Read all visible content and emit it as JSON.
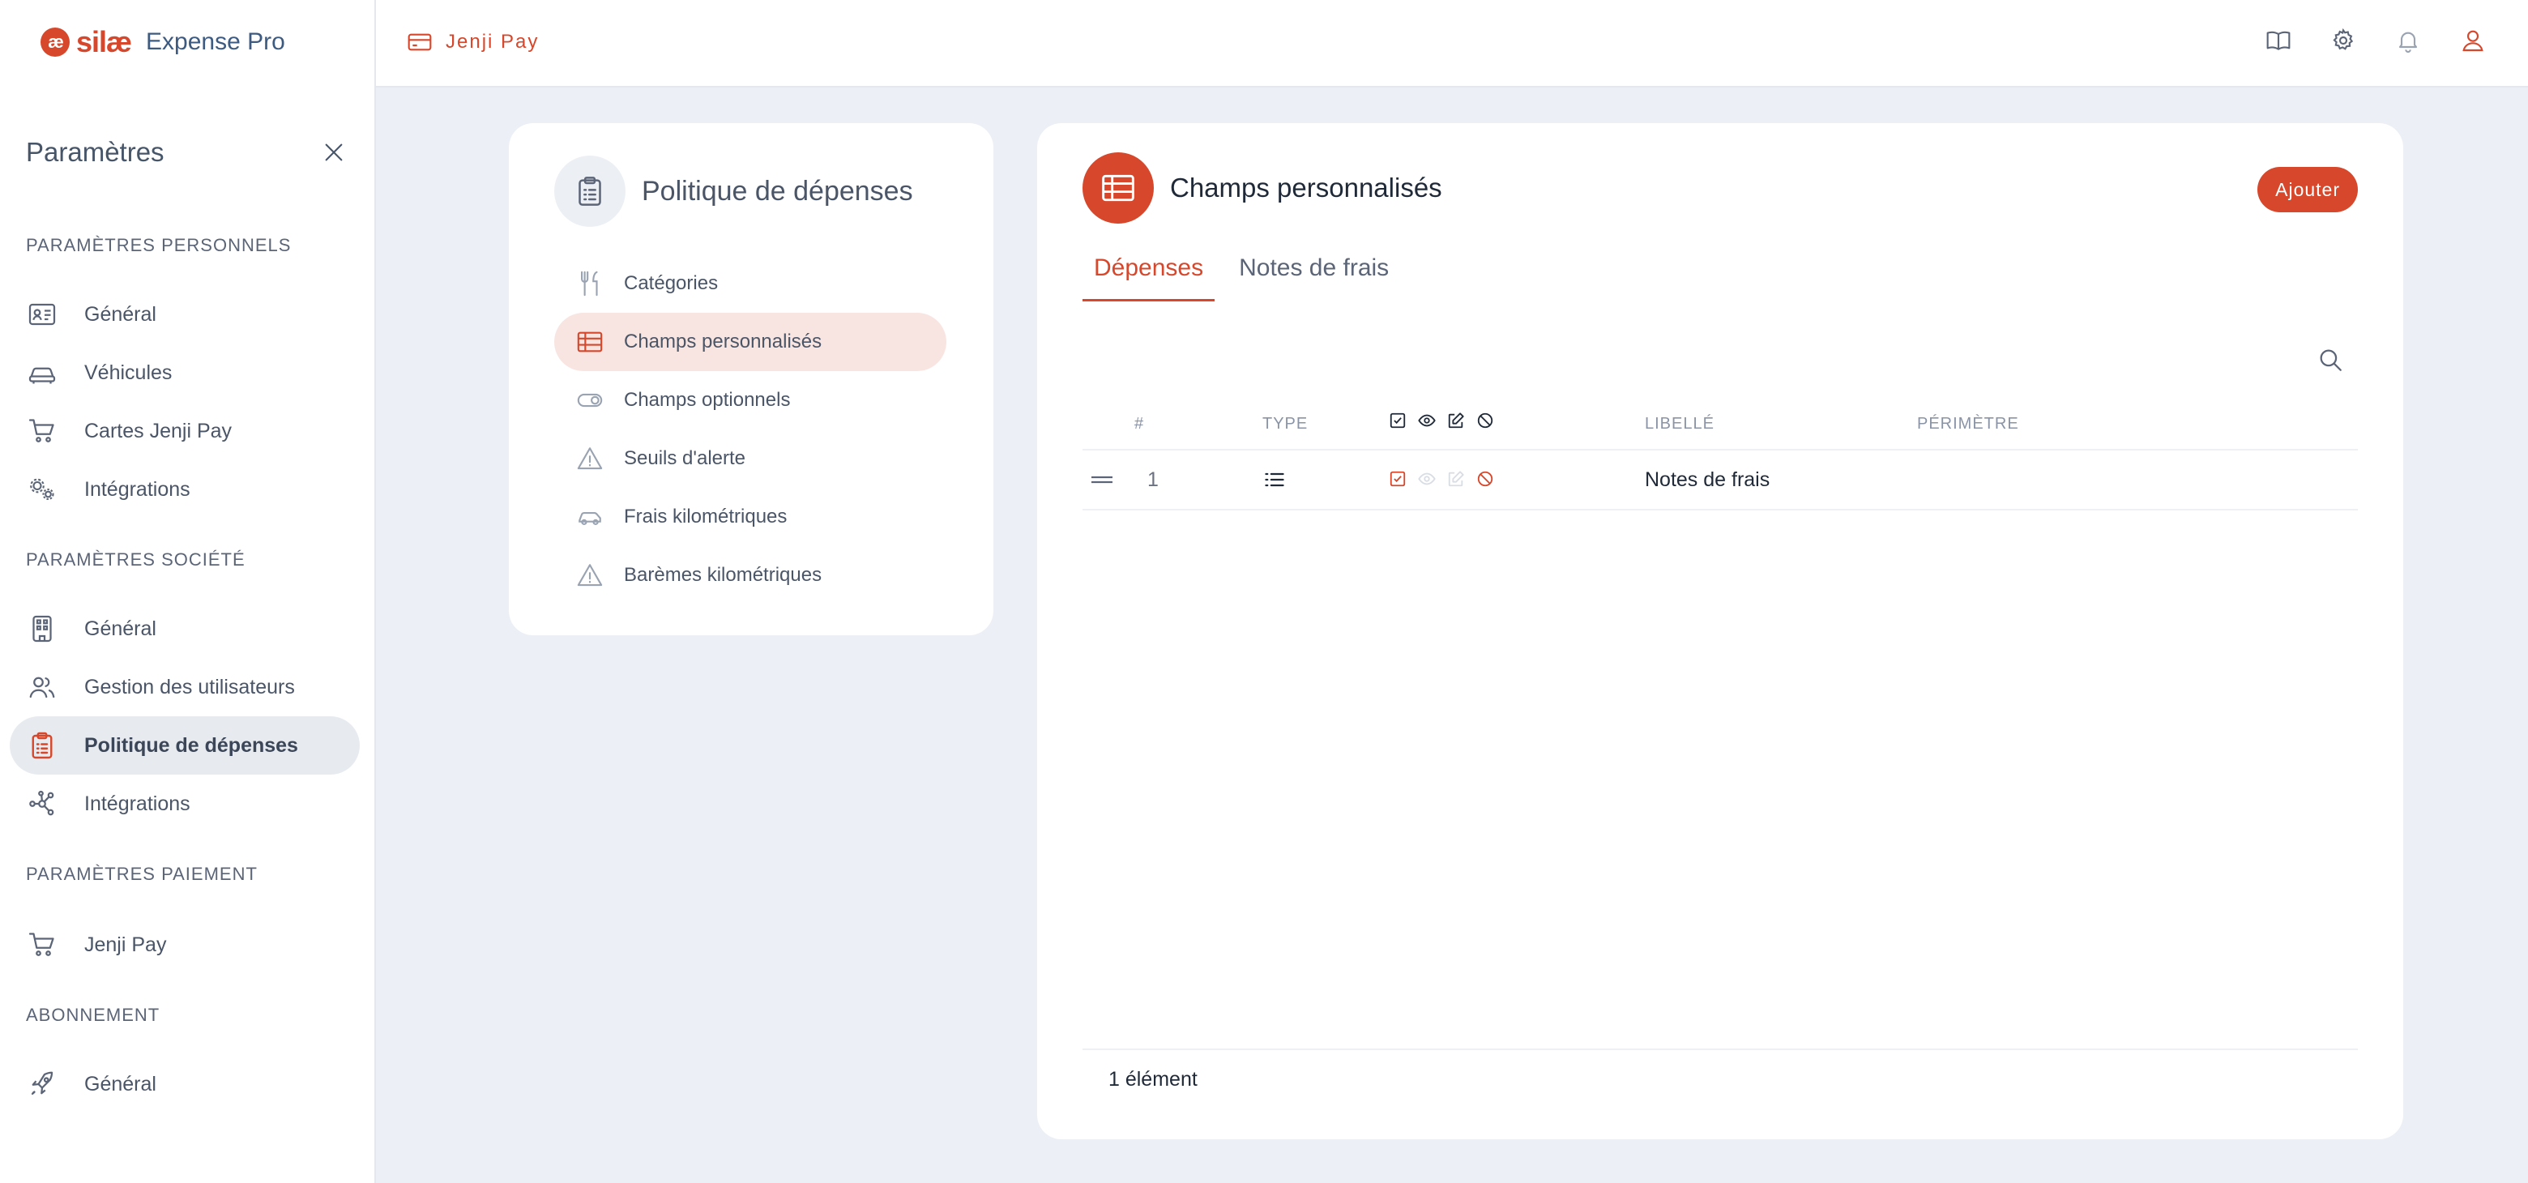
{
  "app": {
    "logo_mark": "æ",
    "logo_brand": "silæ",
    "logo_product": "Expense Pro",
    "brand_color": "#d6472b"
  },
  "topbar": {
    "brand_label": "Jenji Pay",
    "icons": [
      "book-icon",
      "gear-icon",
      "bell-icon",
      "user-icon"
    ]
  },
  "sidebar": {
    "title": "Paramètres",
    "sections": [
      {
        "label": "PARAMÈTRES PERSONNELS",
        "items": [
          {
            "label": "Général",
            "icon": "id-card-icon"
          },
          {
            "label": "Véhicules",
            "icon": "car-icon"
          },
          {
            "label": "Cartes Jenji Pay",
            "icon": "cart-icon"
          },
          {
            "label": "Intégrations",
            "icon": "gears-icon"
          }
        ]
      },
      {
        "label": "PARAMÈTRES SOCIÉTÉ",
        "items": [
          {
            "label": "Général",
            "icon": "building-icon"
          },
          {
            "label": "Gestion des utilisateurs",
            "icon": "users-icon"
          },
          {
            "label": "Politique de dépenses",
            "icon": "clipboard-icon",
            "active": true
          },
          {
            "label": "Intégrations",
            "icon": "network-icon"
          }
        ]
      },
      {
        "label": "PARAMÈTRES PAIEMENT",
        "items": [
          {
            "label": "Jenji Pay",
            "icon": "cart-icon"
          }
        ]
      },
      {
        "label": "ABONNEMENT",
        "items": [
          {
            "label": "Général",
            "icon": "rocket-icon"
          }
        ]
      }
    ]
  },
  "policy": {
    "title": "Politique de dépenses",
    "items": [
      {
        "label": "Catégories",
        "icon": "utensils-icon"
      },
      {
        "label": "Champs personnalisés",
        "icon": "table-icon",
        "active": true
      },
      {
        "label": "Champs optionnels",
        "icon": "toggle-icon"
      },
      {
        "label": "Seuils d'alerte",
        "icon": "warning-icon"
      },
      {
        "label": "Frais kilométriques",
        "icon": "car-icon"
      },
      {
        "label": "Barèmes kilométriques",
        "icon": "warning-icon"
      }
    ]
  },
  "main": {
    "title": "Champs personnalisés",
    "add_label": "Ajouter",
    "tabs": [
      {
        "label": "Dépenses",
        "active": true
      },
      {
        "label": "Notes de frais",
        "active": false
      }
    ],
    "table": {
      "columns": {
        "num": "#",
        "type": "TYPE",
        "label": "LIBELLÉ",
        "scope": "PÉRIMÈTRE"
      },
      "rows": [
        {
          "num": "1",
          "type_icon": "list-icon",
          "label": "Notes de frais",
          "scope": ""
        }
      ]
    },
    "footer_count": "1 élément"
  }
}
